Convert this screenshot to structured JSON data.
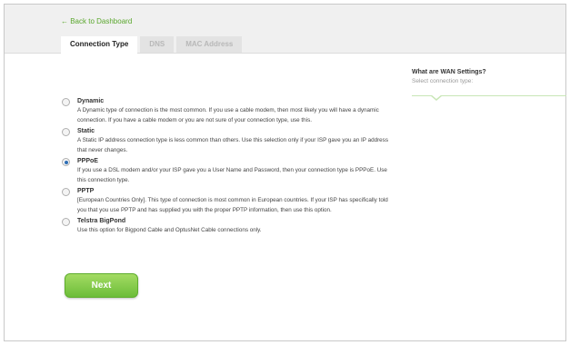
{
  "header": {
    "back_link": "← Back to Dashboard",
    "tabs": [
      {
        "label": "Connection Type",
        "active": true
      },
      {
        "label": "DNS",
        "active": false
      },
      {
        "label": "MAC Address",
        "active": false
      }
    ]
  },
  "options": [
    {
      "title": "Dynamic",
      "selected": false,
      "desc": "A Dynamic type of connection is the most common. If you use a cable modem, then most likely you will have a dynamic connection. If you have a cable modem or you are not sure of your connection type, use this."
    },
    {
      "title": "Static",
      "selected": false,
      "desc": "A Static IP address connection type is less common than others. Use this selection only if your ISP gave you an IP address that never changes."
    },
    {
      "title": "PPPoE",
      "selected": true,
      "desc": "If you use a DSL modem and/or your ISP gave you a User Name and Password, then your connection type is PPPoE. Use this connection type."
    },
    {
      "title": "PPTP",
      "selected": false,
      "desc": "[European Countries Only]. This type of connection is most common in European countries. If your ISP has specifically told you that you use PPTP and has supplied you with the proper PPTP information, then use this option."
    },
    {
      "title": "Telstra BigPond",
      "selected": false,
      "desc": "Use this option for Bigpond Cable and OptusNet Cable connections only."
    }
  ],
  "next_label": "Next",
  "help": {
    "title": "What are WAN Settings?",
    "subtitle": "Select connection type:"
  },
  "colors": {
    "accent_green": "#6cbd39",
    "link_green": "#5aa72d",
    "radio_selected": "#2f6fb6"
  }
}
